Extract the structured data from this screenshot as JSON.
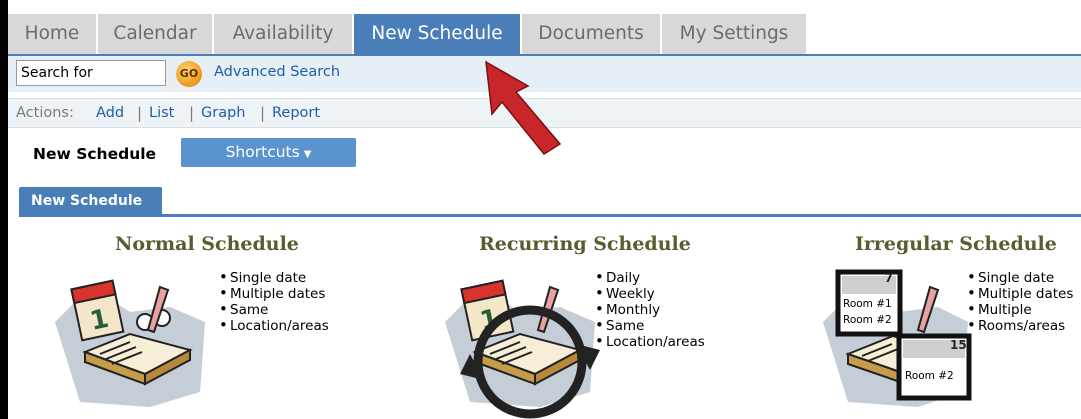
{
  "tabs": [
    {
      "label": "Home",
      "active": false
    },
    {
      "label": "Calendar",
      "active": false
    },
    {
      "label": "Availability",
      "active": false
    },
    {
      "label": "New Schedule",
      "active": true
    },
    {
      "label": "Documents",
      "active": false
    },
    {
      "label": "My Settings",
      "active": false
    }
  ],
  "search": {
    "value": "Search for",
    "go_label": "GO",
    "advanced_label": "Advanced Search"
  },
  "actions": {
    "label": "Actions:",
    "links": [
      "Add",
      "List",
      "Graph",
      "Report"
    ]
  },
  "page": {
    "title": "New Schedule",
    "shortcuts_label": "Shortcuts",
    "inner_tab": "New Schedule"
  },
  "cards": [
    {
      "title": "Normal Schedule",
      "bullets": [
        "Single date",
        "Multiple dates",
        "Same",
        "Location/areas"
      ]
    },
    {
      "title": "Recurring Schedule",
      "bullets": [
        "Daily",
        "Weekly",
        "Monthly",
        "Same",
        "Location/areas"
      ]
    },
    {
      "title": "Irregular Schedule",
      "bullets": [
        "Single date",
        "Multiple dates",
        "Multiple",
        "Rooms/areas"
      ],
      "art_labels": [
        "7",
        "Room #1",
        "Room #2",
        "15",
        "Room #2"
      ]
    }
  ],
  "colors": {
    "accent": "#4a7eb8",
    "link": "#1f5ea8",
    "card_title": "#5c5a2e",
    "arrow": "#c8262a"
  },
  "icons": {
    "go": "go-button-icon",
    "dropdown": "chevron-down-icon",
    "arrow": "pointer-arrow-icon"
  }
}
